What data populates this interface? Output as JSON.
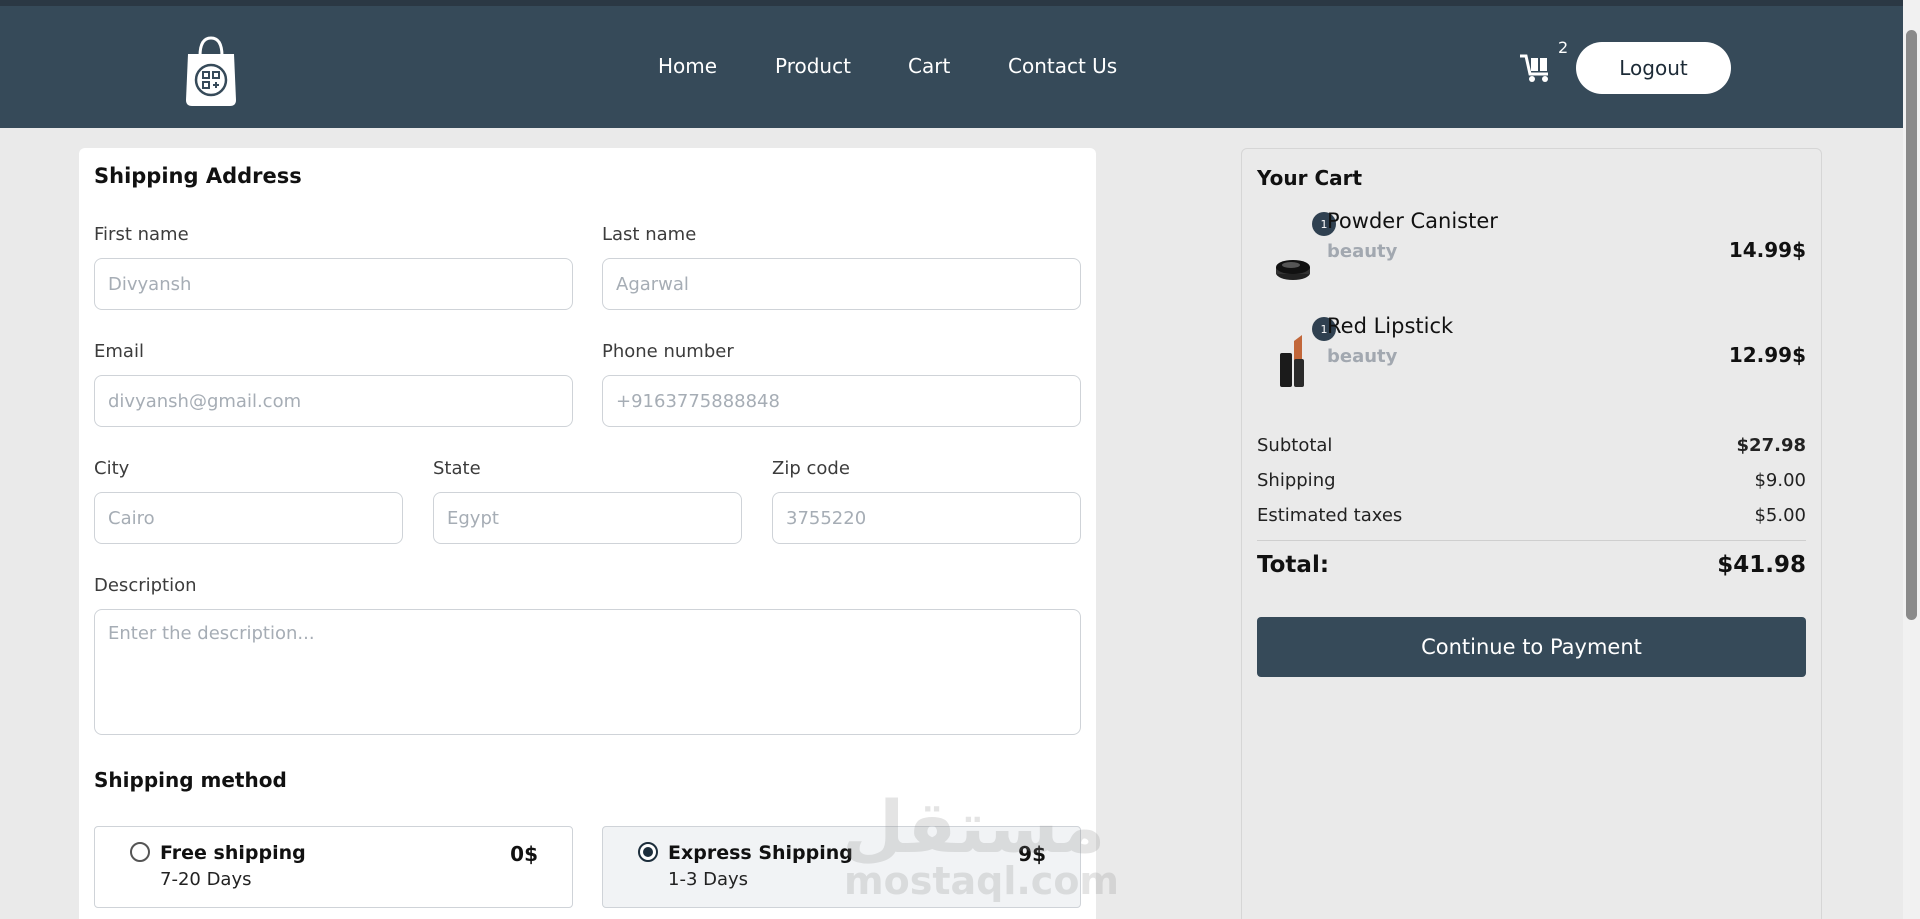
{
  "header": {
    "nav": [
      "Home",
      "Product",
      "Cart",
      "Contact Us"
    ],
    "cart_count": "2",
    "logout_label": "Logout"
  },
  "shipping": {
    "title": "Shipping Address",
    "fields": {
      "first_name": {
        "label": "First name",
        "placeholder": "Divyansh"
      },
      "last_name": {
        "label": "Last name",
        "placeholder": "Agarwal"
      },
      "email": {
        "label": "Email",
        "placeholder": "divyansh@gmail.com"
      },
      "phone": {
        "label": "Phone number",
        "placeholder": "+9163775888848"
      },
      "city": {
        "label": "City",
        "placeholder": "Cairo"
      },
      "state": {
        "label": "State",
        "placeholder": "Egypt"
      },
      "zip": {
        "label": "Zip code",
        "placeholder": "3755220"
      },
      "description": {
        "label": "Description",
        "placeholder": "Enter the description..."
      }
    },
    "method_title": "Shipping method",
    "methods": [
      {
        "name": "Free shipping",
        "days": "7-20 Days",
        "price": "0$",
        "selected": false
      },
      {
        "name": "Express Shipping",
        "days": "1-3 Days",
        "price": "9$",
        "selected": true
      }
    ]
  },
  "cart": {
    "title": "Your Cart",
    "items": [
      {
        "name": "Powder Canister",
        "category": "beauty",
        "price": "14.99$",
        "qty": "1"
      },
      {
        "name": "Red Lipstick",
        "category": "beauty",
        "price": "12.99$",
        "qty": "1"
      }
    ],
    "subtotal_label": "Subtotal",
    "subtotal": "$27.98",
    "shipping_label": "Shipping",
    "shipping": "$9.00",
    "taxes_label": "Estimated taxes",
    "taxes": "$5.00",
    "total_label": "Total:",
    "total": "$41.98",
    "pay_label": "Continue to Payment"
  },
  "watermark": {
    "arabic": "مستقل",
    "latin": "mostaql.com"
  },
  "colors": {
    "header": "#364a59",
    "accent": "#364a59",
    "badge": "#2f4050"
  }
}
